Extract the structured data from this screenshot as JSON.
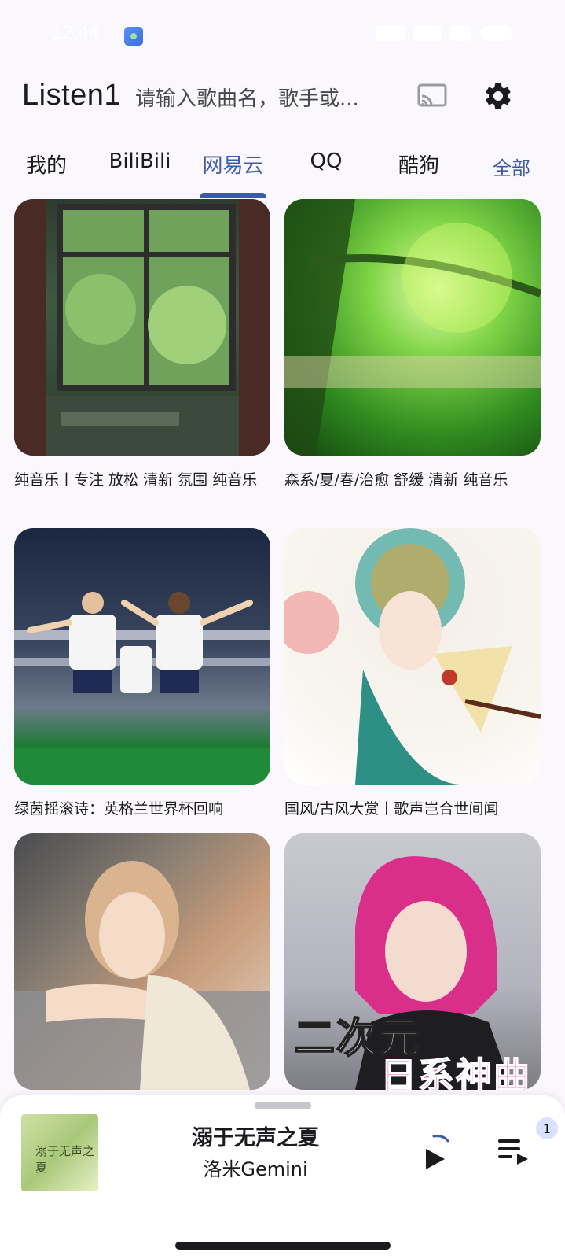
{
  "status": {
    "time": "12:44"
  },
  "app": {
    "title": "Listen1"
  },
  "search": {
    "placeholder": "请输入歌曲名，歌手或..."
  },
  "tabs": [
    {
      "label": "我的"
    },
    {
      "label": "BiliBili"
    },
    {
      "label": "网易云",
      "active": true
    },
    {
      "label": "QQ"
    },
    {
      "label": "酷狗"
    },
    {
      "label": "全部"
    }
  ],
  "playlists": [
    {
      "title": "纯音乐丨专注 放松 清新 氛围 纯音乐"
    },
    {
      "title": "森系/夏/春/治愈 舒缓 清新 纯音乐"
    },
    {
      "title": "绿茵摇滚诗：英格兰世界杯回响"
    },
    {
      "title": "国风/古风大赏丨歌声岂合世间闻"
    },
    {
      "title": ""
    },
    {
      "title": "",
      "cover_text": [
        "二次元",
        "日系神曲"
      ]
    }
  ],
  "player": {
    "title": "溺于无声之夏",
    "artist": "洛米Gemini",
    "queue_count": "1",
    "art_text": "溺于无声之夏"
  },
  "colors": {
    "accent": "#3b5ba9",
    "background": "#fbf8fd"
  }
}
